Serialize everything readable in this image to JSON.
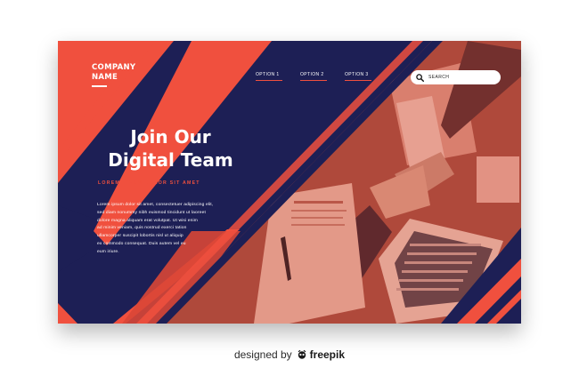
{
  "brand": {
    "line1": "COMPANY",
    "line2": "NAME"
  },
  "nav": {
    "items": [
      {
        "label": "OPTION 1"
      },
      {
        "label": "OPTION 2"
      },
      {
        "label": "OPTION 3"
      }
    ]
  },
  "search": {
    "placeholder": "SEARCH",
    "icon": "search-icon"
  },
  "hero": {
    "headline_line1": "Join Our",
    "headline_line2": "Digital Team",
    "tagline": "LOREM IPSUM DOLOR SIT AMET",
    "body": [
      "Lorem ipsum dolor sit amet, consectetuer adipiscing elit,",
      "sed diam nonummy nibh euismod tincidunt ut laoreet",
      "dolore magna aliquam erat volutpat. Ut wisi enim",
      "ad minim veniam, quis nostrud exerci tation",
      "ullamcorper suscipit lobortis nisl ut aliquip",
      "ex commodo consequat. Duis autem vel eu",
      "eum iriure."
    ]
  },
  "credit": {
    "designed_by": "designed by",
    "brand": "freepik"
  },
  "colors": {
    "navy": "#1d1f55",
    "coral": "#f0503e",
    "photo_tint": "#9c4236",
    "white": "#ffffff"
  }
}
